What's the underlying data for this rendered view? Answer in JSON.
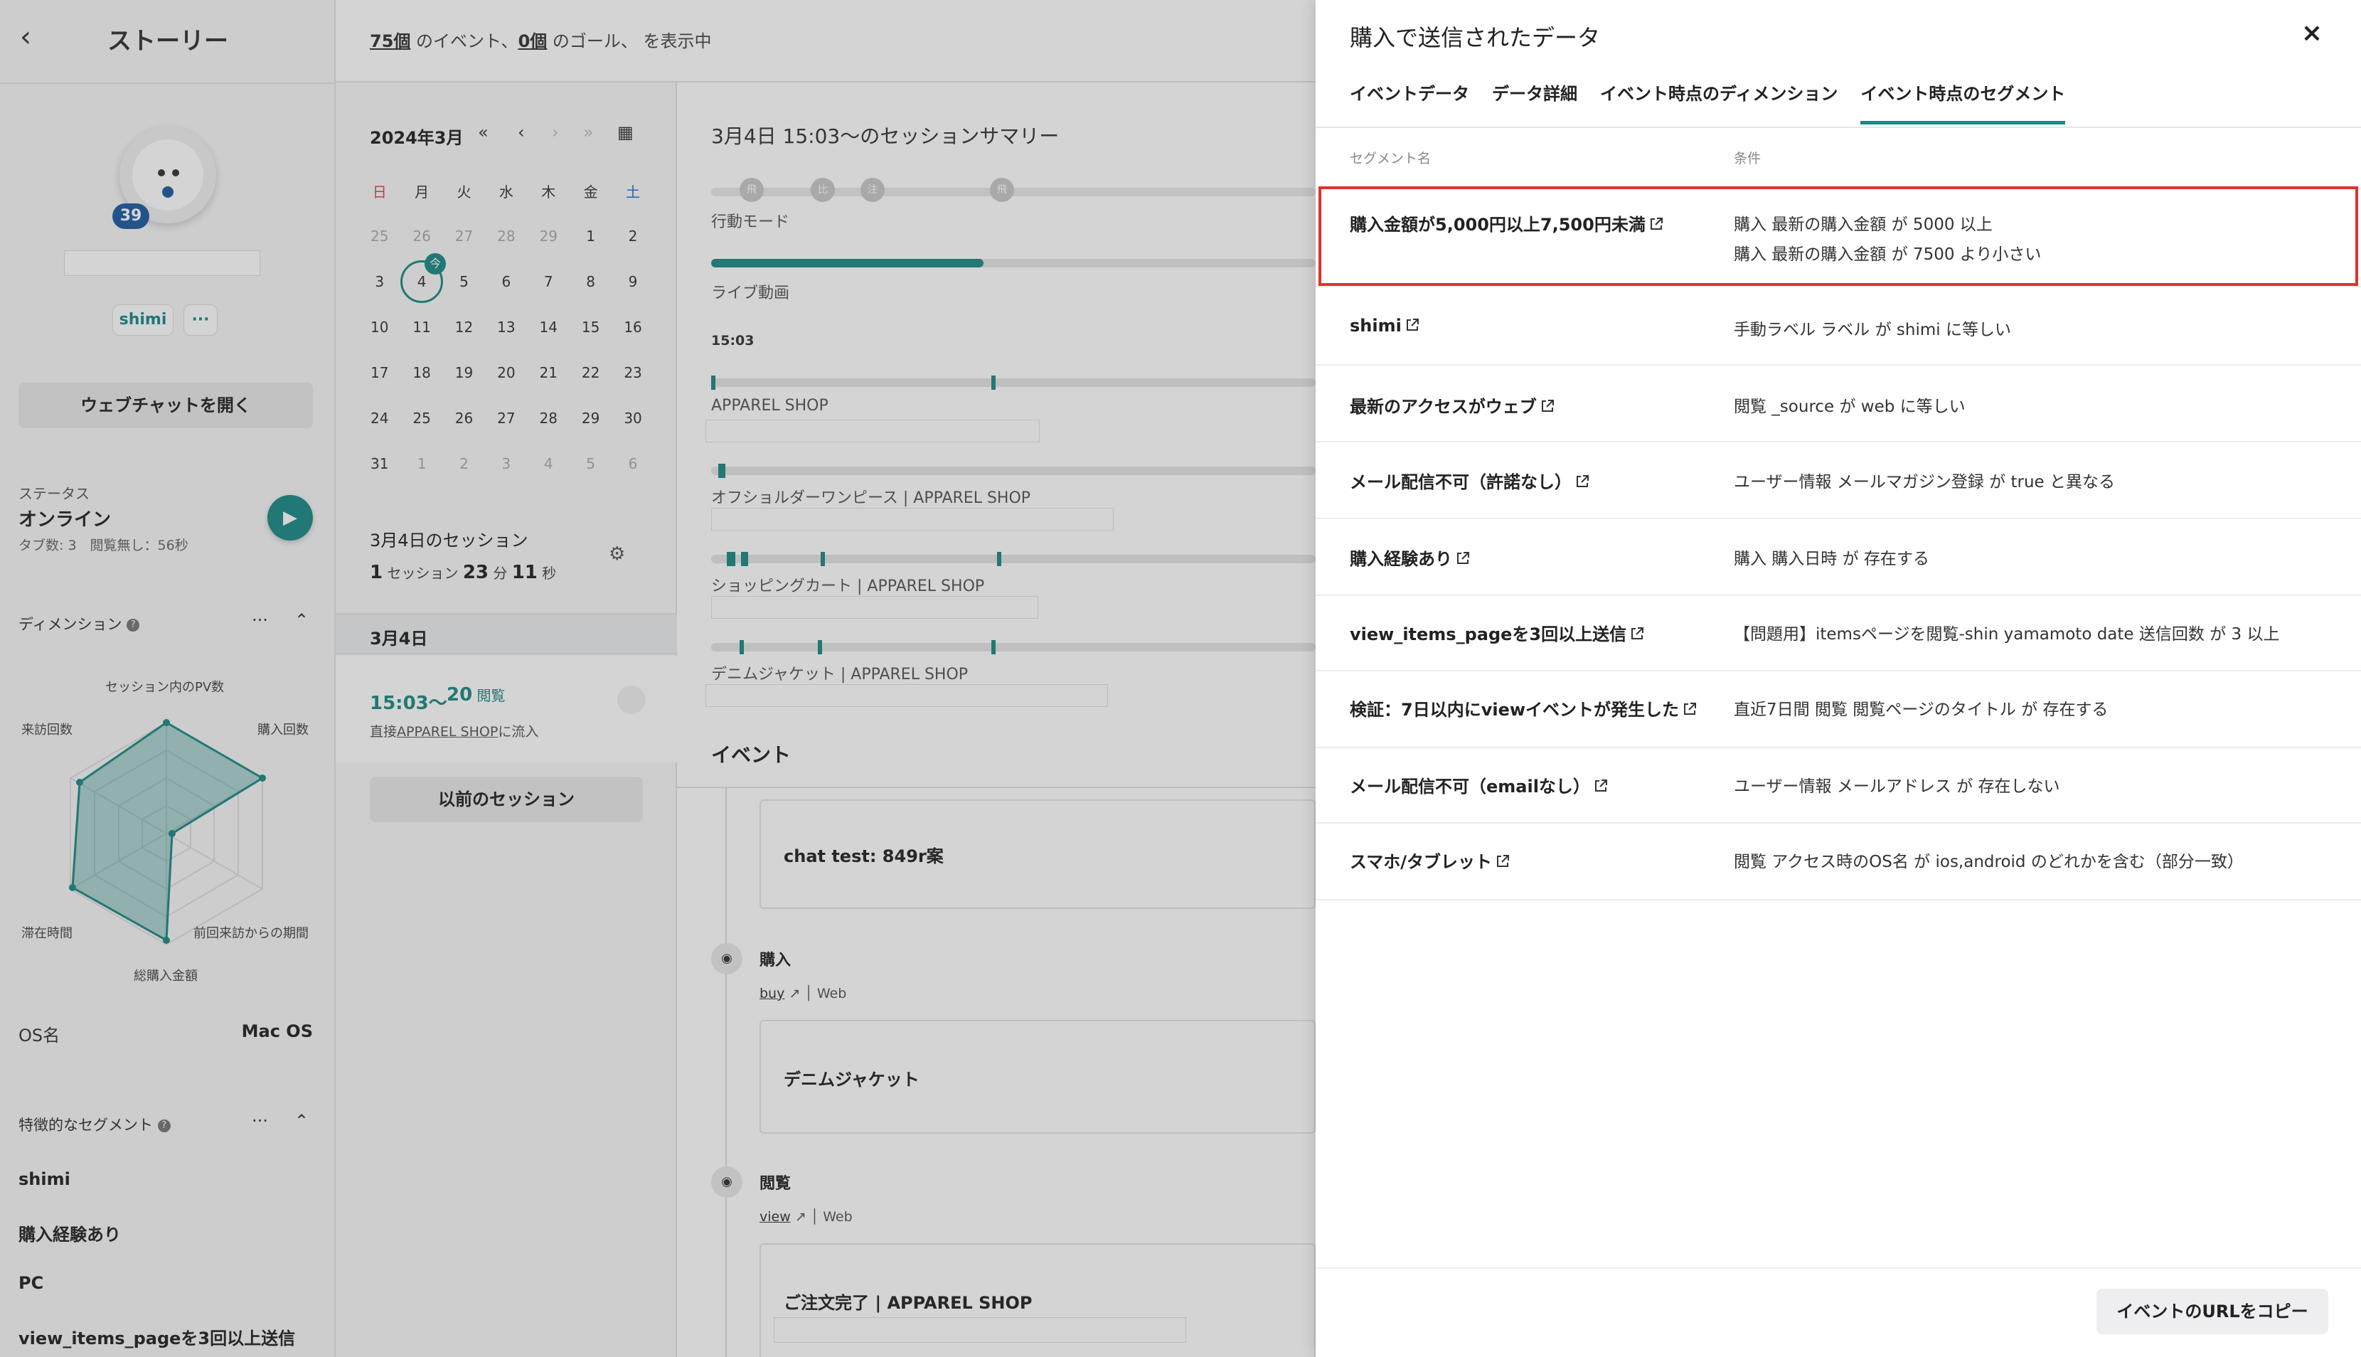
{
  "left": {
    "title": "ストーリー",
    "pv_count": "39",
    "chips": [
      "shimi",
      "···"
    ],
    "webchat_button": "ウェブチャットを開く",
    "status_label": "ステータス",
    "status_value": "オンライン",
    "status_sub": "タブ数: 3　閲覧無し：56秒",
    "dimension_label": "ディメンション",
    "more": "···",
    "radar_labels": [
      "セッション内のPV数",
      "購入回数",
      "前回来訪からの期間",
      "総購入金額",
      "滞在時間",
      "来訪回数"
    ],
    "os_label": "OS名",
    "os_value": "Mac OS",
    "segments_label": "特徴的なセグメント",
    "segments": [
      "shimi",
      "購入経験あり",
      "PC",
      "view_items_pageを3回以上送信"
    ]
  },
  "mid": {
    "summary_text": {
      "events": "75個",
      "events_suffix": " のイベント、",
      "goals": "0個",
      "goals_suffix": " のゴール、 を表示中"
    },
    "calendar": {
      "month": "2024年3月",
      "nav": [
        "«",
        "‹",
        "›",
        "»",
        "▦"
      ],
      "weekdays": [
        "日",
        "月",
        "火",
        "水",
        "木",
        "金",
        "土"
      ],
      "weeks": [
        [
          "25",
          "26",
          "27",
          "28",
          "29",
          "1",
          "2"
        ],
        [
          "3",
          "4",
          "5",
          "6",
          "7",
          "8",
          "9"
        ],
        [
          "10",
          "11",
          "12",
          "13",
          "14",
          "15",
          "16"
        ],
        [
          "17",
          "18",
          "19",
          "20",
          "21",
          "22",
          "23"
        ],
        [
          "24",
          "25",
          "26",
          "27",
          "28",
          "29",
          "30"
        ],
        [
          "31",
          "1",
          "2",
          "3",
          "4",
          "5",
          "6"
        ]
      ],
      "today_flag": "今"
    },
    "session": {
      "head": "3月4日のセッション",
      "count": "1",
      "count_unit": " セッション ",
      "min": "23",
      "min_unit": " 分 ",
      "sec": "11",
      "sec_unit": " 秒",
      "date": "3月4日",
      "time": "15:03〜",
      "pv": "20",
      "pv_unit": " 閲覧",
      "source_prefix": "直接",
      "source_link": "APPAREL SHOP",
      "source_suffix": "に流入",
      "prev_button": "以前のセッション"
    },
    "summary": {
      "title": "3月4日 15:03〜のセッションサマリー",
      "mode_label": "行動モード",
      "mode_dots": [
        "飛",
        "比",
        "注",
        "飛"
      ],
      "live_label": "ライブ動画",
      "time_label": "15:03",
      "live_progress": 0.45,
      "pages": [
        "APPAREL SHOP",
        "オフショルダーワンピース | APPAREL SHOP",
        "ショッピングカート | APPAREL SHOP",
        "デニムジャケット | APPAREL SHOP"
      ]
    },
    "events": {
      "title": "イベント",
      "items": [
        {
          "card": "chat test: 849r案"
        },
        {
          "name": "購入",
          "link": "buy",
          "channel": "Web",
          "card": "デニムジャケット"
        },
        {
          "name": "閲覧",
          "link": "view",
          "channel": "Web",
          "card": "ご注文完了 | APPAREL SHOP"
        }
      ]
    }
  },
  "drawer": {
    "title": "購入で送信されたデータ",
    "close": "×",
    "tabs": [
      "イベントデータ",
      "データ詳細",
      "イベント時点のディメンション",
      "イベント時点のセグメント"
    ],
    "active_tab": 3,
    "col_name": "セグメント名",
    "col_cond": "条件",
    "rows": [
      {
        "name": "購入金額が5,000円以上7,500円未満",
        "cond": [
          "購入 最新の購入金額 が 5000 以上",
          "購入 最新の購入金額 が 7500 より小さい"
        ]
      },
      {
        "name": "shimi",
        "cond": [
          "手動ラベル ラベル が shimi に等しい"
        ]
      },
      {
        "name": "最新のアクセスがウェブ",
        "cond": [
          "閲覧 _source が web に等しい"
        ]
      },
      {
        "name": "メール配信不可（許諾なし）",
        "cond": [
          "ユーザー情報 メールマガジン登録 が true と異なる"
        ]
      },
      {
        "name": "購入経験あり",
        "cond": [
          "購入 購入日時 が 存在する"
        ]
      },
      {
        "name": "view_items_pageを3回以上送信",
        "cond": [
          "【問題用】itemsページを閲覧-shin yamamoto date 送信回数 が 3 以上"
        ]
      },
      {
        "name": "検証：7日以内にviewイベントが発生した",
        "cond": [
          "直近7日間 閲覧 閲覧ページのタイトル が 存在する"
        ]
      },
      {
        "name": "メール配信不可（emailなし）",
        "cond": [
          "ユーザー情報 メールアドレス が 存在しない"
        ]
      },
      {
        "name": "スマホ/タブレット",
        "cond": [
          "閲覧 アクセス時のOS名 が ios,android のどれかを含む（部分一致）"
        ]
      }
    ],
    "copy_button": "イベントのURLをコピー",
    "accent": "#1a8a85",
    "highlight": "#e0332a"
  }
}
